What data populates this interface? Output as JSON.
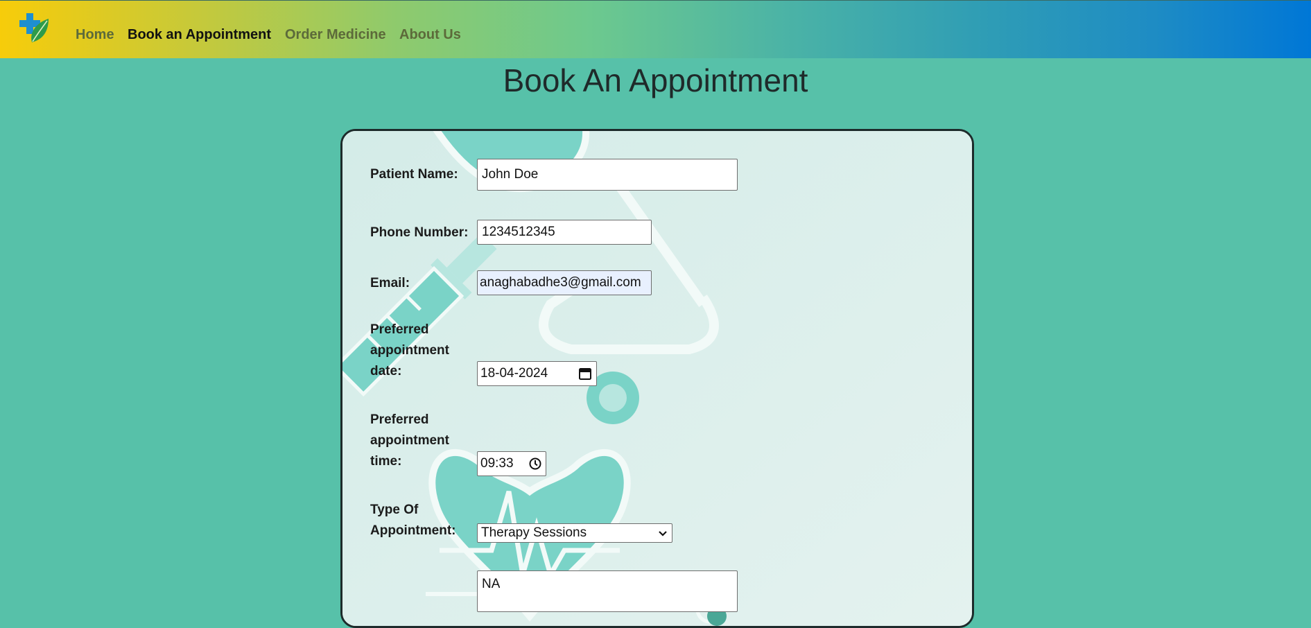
{
  "nav": {
    "logo_icon": "medical-cross-leaf-icon",
    "links": [
      {
        "label": "Home",
        "active": false
      },
      {
        "label": "Book an Appointment",
        "active": true
      },
      {
        "label": "Order Medicine",
        "active": false
      },
      {
        "label": "About Us",
        "active": false
      }
    ]
  },
  "page": {
    "title": "Book An Appointment"
  },
  "form": {
    "patient_name": {
      "label": "Patient Name:",
      "value": "John Doe"
    },
    "phone": {
      "label": "Phone Number:",
      "value": "1234512345"
    },
    "email": {
      "label": "Email:",
      "value": "anaghabadhe3@gmail.com"
    },
    "date": {
      "label_lines": [
        "Preferred",
        "appointment",
        "date:"
      ],
      "value": "18-04-2024",
      "icon": "calendar-icon"
    },
    "time": {
      "label_lines": [
        "Preferred",
        "appointment",
        "time:"
      ],
      "value": "09:33",
      "icon": "clock-icon"
    },
    "type": {
      "label_lines": [
        "Type Of",
        "Appointment:"
      ],
      "value": "Therapy Sessions",
      "icon": "chevron-down-icon"
    },
    "notes": {
      "value": "NA"
    }
  },
  "colors": {
    "page_bg": "#57c1a9",
    "card_bg": "#d8eeea",
    "accent": "#7ad3c7",
    "nav_gradient_start": "#f7cc0a",
    "nav_gradient_end": "#0077d6"
  }
}
